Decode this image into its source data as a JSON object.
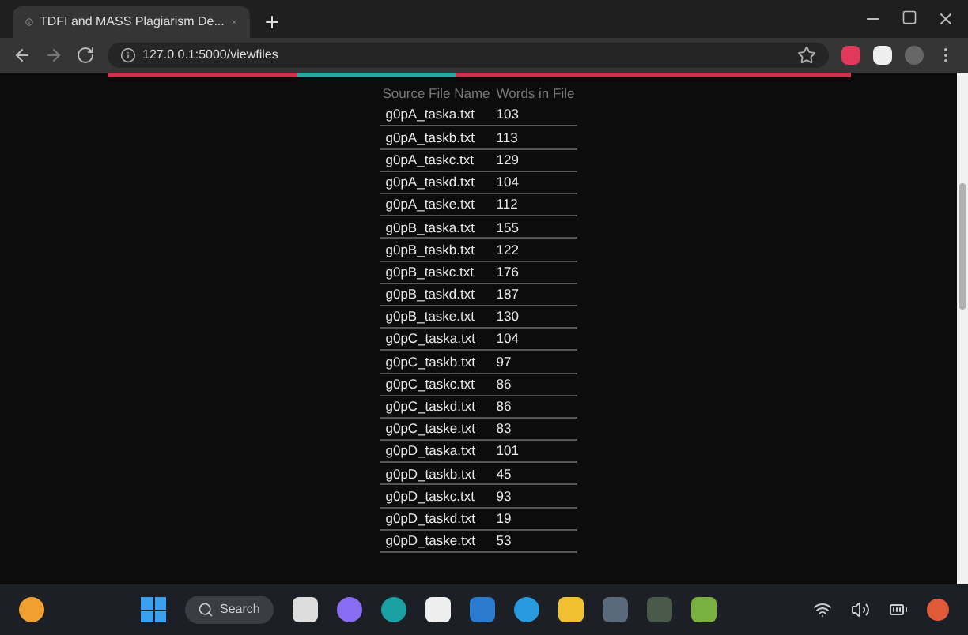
{
  "browser": {
    "tab_title": "TDFI and MASS Plagiarism De...",
    "url": "127.0.0.1:5000/viewfiles"
  },
  "table": {
    "columns": [
      "Source File Name",
      "Words in File"
    ],
    "rows": [
      [
        "g0pA_taska.txt",
        "103"
      ],
      [
        "g0pA_taskb.txt",
        "113"
      ],
      [
        "g0pA_taskc.txt",
        "129"
      ],
      [
        "g0pA_taskd.txt",
        "104"
      ],
      [
        "g0pA_taske.txt",
        "112"
      ],
      [
        "g0pB_taska.txt",
        "155"
      ],
      [
        "g0pB_taskb.txt",
        "122"
      ],
      [
        "g0pB_taskc.txt",
        "176"
      ],
      [
        "g0pB_taskd.txt",
        "187"
      ],
      [
        "g0pB_taske.txt",
        "130"
      ],
      [
        "g0pC_taska.txt",
        "104"
      ],
      [
        "g0pC_taskb.txt",
        "97"
      ],
      [
        "g0pC_taskc.txt",
        "86"
      ],
      [
        "g0pC_taskd.txt",
        "86"
      ],
      [
        "g0pC_taske.txt",
        "83"
      ],
      [
        "g0pD_taska.txt",
        "101"
      ],
      [
        "g0pD_taskb.txt",
        "45"
      ],
      [
        "g0pD_taskc.txt",
        "93"
      ],
      [
        "g0pD_taskd.txt",
        "19"
      ],
      [
        "g0pD_taske.txt",
        "53"
      ]
    ]
  },
  "taskbar": {
    "search_placeholder": "Search"
  }
}
